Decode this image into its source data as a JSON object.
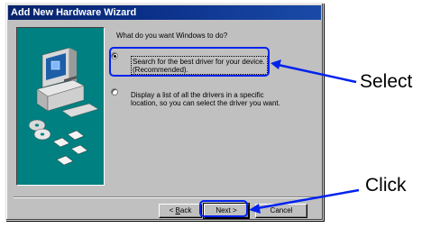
{
  "window": {
    "title": "Add New Hardware Wizard",
    "question": "What do you want Windows to do?"
  },
  "options": [
    {
      "label": "Search for the best driver for your device. (Recommended).",
      "selected": true
    },
    {
      "label": "Display a list of all the drivers in a specific location, so you can select the driver you want.",
      "selected": false
    }
  ],
  "buttons": {
    "back_prefix": "< ",
    "back_accel": "B",
    "back_rest": "ack",
    "next": "Next >",
    "cancel": "Cancel"
  },
  "annotations": {
    "select": "Select",
    "click": "Click"
  },
  "colors": {
    "accent": "#0022ee",
    "teal": "#008080",
    "titlebar": "#08246b"
  }
}
